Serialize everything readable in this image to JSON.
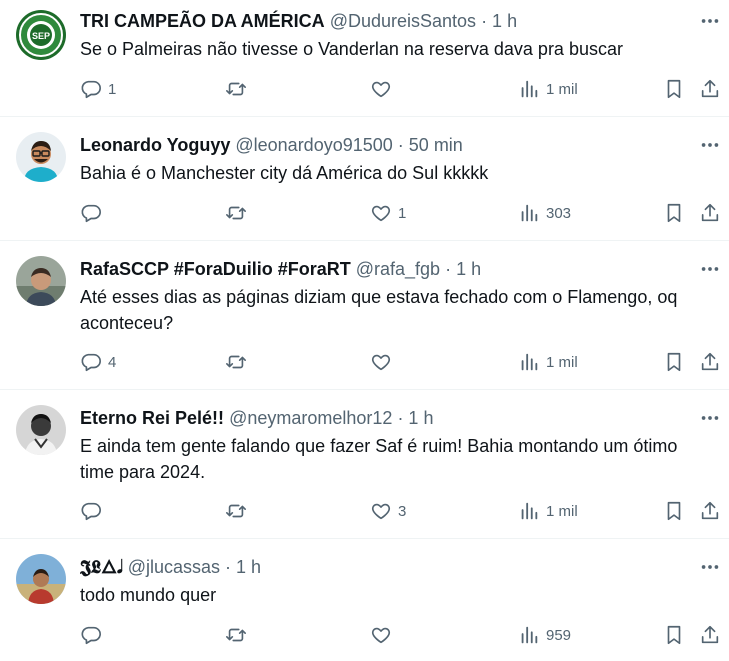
{
  "tweets": [
    {
      "name": "TRI CAMPEÃO DA AMÉRICA",
      "handle": "@DudureisSantos",
      "time": "· 1 h",
      "text": "Se o Palmeiras não tivesse o Vanderlan na reserva dava pra buscar",
      "replies": "1",
      "retweets": "",
      "likes": "",
      "views": "1 mil",
      "avatar": "palmeiras-crest"
    },
    {
      "name": "Leonardo Yoguyy",
      "handle": "@leonardoyo91500",
      "time": "· 50 min",
      "text": "Bahia é o Manchester city dá América do Sul kkkkk",
      "replies": "",
      "retweets": "",
      "likes": "1",
      "views": "303",
      "avatar": "cartoon-man-glasses"
    },
    {
      "name": "RafaSCCP #ForaDuilio #ForaRT",
      "handle": "@rafa_fgb",
      "time": "· 1 h",
      "text": "Até esses dias as páginas diziam que estava fechado com o Flamengo, oq aconteceu?",
      "replies": "4",
      "retweets": "",
      "likes": "",
      "views": "1 mil",
      "avatar": "man-photo"
    },
    {
      "name": "Eterno Rei Pelé!!",
      "handle": "@neymaromelhor12",
      "time": "· 1 h",
      "text": "E ainda tem gente falando que fazer Saf é ruim! Bahia montando um ótimo time para 2024.",
      "replies": "",
      "retweets": "",
      "likes": "3",
      "views": "1 mil",
      "avatar": "bw-player-photo"
    },
    {
      "name": "𝕵𝕷🜂𝅘𝅥",
      "handle": "@jlucassas",
      "time": "· 1 h",
      "text": "todo mundo quer",
      "replies": "",
      "retweets": "",
      "likes": "",
      "views": "959",
      "avatar": "person-outdoor-photo"
    }
  ],
  "icons": {
    "reply": "reply-icon",
    "retweet": "retweet-icon",
    "like": "heart-icon",
    "views": "views-chart-icon",
    "bookmark": "bookmark-icon",
    "share": "share-icon",
    "more": "more-dots-icon"
  },
  "colors": {
    "text": "#0f1419",
    "muted": "#536471",
    "divider": "#eff3f4"
  }
}
